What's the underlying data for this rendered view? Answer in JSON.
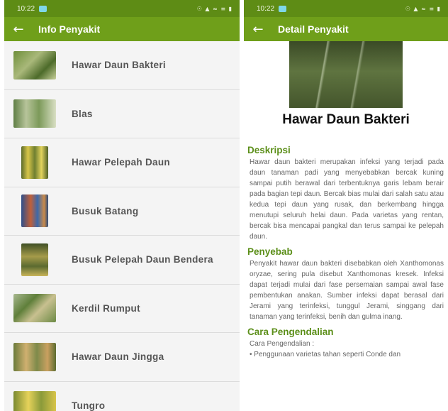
{
  "left": {
    "status": {
      "time": "10:22",
      "icons": "☉ ▲ ≈ ≡ ▮"
    },
    "appbar": {
      "back": "←",
      "title": "Info Penyakit"
    },
    "items": [
      {
        "label": "Hawar Daun Bakteri"
      },
      {
        "label": "Blas"
      },
      {
        "label": "Hawar Pelepah Daun"
      },
      {
        "label": "Busuk Batang"
      },
      {
        "label": "Busuk Pelepah Daun Bendera"
      },
      {
        "label": "Kerdil Rumput"
      },
      {
        "label": "Hawar Daun Jingga"
      },
      {
        "label": "Tungro"
      }
    ]
  },
  "right": {
    "status": {
      "time": "10:22",
      "icons": "☉ ▲ ≈ ≡ ▮"
    },
    "appbar": {
      "back": "←",
      "title": "Detail Penyakit"
    },
    "title": "Hawar Daun Bakteri",
    "sections": [
      {
        "heading": "Deskripsi",
        "body": "Hawar daun bakteri merupakan infeksi yang terjadi pada daun tanaman padi yang menyebabkan bercak kuning sampai putih berawal dari terbentuknya garis lebam berair pada bagian tepi daun. Bercak bias mulai dari salah satu atau kedua tepi daun yang rusak, dan berkembang hingga menutupi seluruh helai daun. Pada varietas yang rentan, bercak bisa mencapai pangkal dan terus sampai ke pelepah daun."
      },
      {
        "heading": "Penyebab",
        "body": "Penyakit hawar daun bakteri disebabkan oleh Xanthomonas oryzae, sering pula disebut Xanthomonas kresek. Infeksi dapat terjadi mulai dari fase persemaian sampai awal fase pembentukan anakan. Sumber infeksi dapat berasal dari Jerami yang terinfeksi, tunggul Jerami, singgang dari tanaman yang terinfeksi, benih dan gulma inang."
      },
      {
        "heading": "Cara Pengendalian",
        "body": "Cara Pengendalian :",
        "bullet": "• Penggunaan varietas tahan seperti Conde dan"
      }
    ]
  }
}
